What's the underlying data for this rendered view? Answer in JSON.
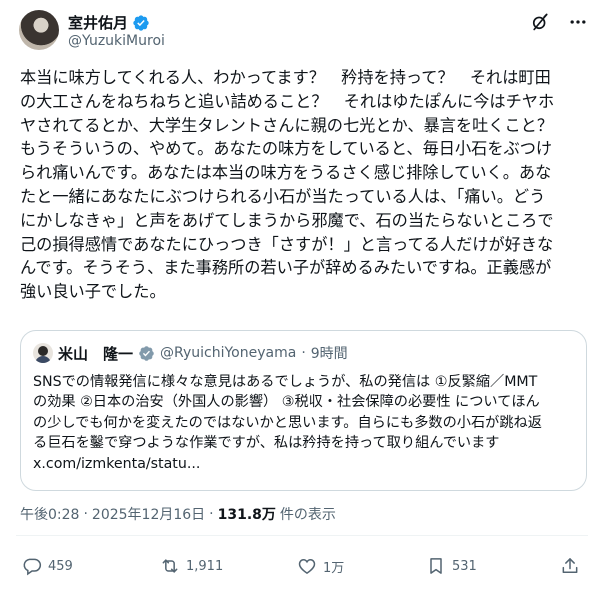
{
  "author": {
    "display_name": "室井佑月",
    "handle": "@YuzukiMuroi"
  },
  "header_icons": [
    "grok-icon",
    "more-icon"
  ],
  "tweet": {
    "text": "本当に味方してくれる人、わかってます？　矜持を持って？　それは町田\nの大工さんをねちねちと追い詰めること？　それはゆたぽんに今はチヤホ\nヤされてるとか、大学生タレントさんに親の七光とか、暴言を吐くこと？\nもうそういうの、やめて。あなたの味方をしていると、毎日小石をぶつけ\nられ痛いんです。あなたは本当の味方をうるさく感じ排除していく。あな\nたと一緒にあなたにぶつけられる小石が当たっている人は、「痛い。どう\nにかしなきゃ」と声をあげてしまうから邪魔で、石の当たらないところで\n己の損得感情であなたにひっつき「さすが！」と言ってる人だけが好きな\nんです。そうそう、また事務所の若い子が辞めるみたいですね。正義感が\n強い良い子でした。"
  },
  "quote": {
    "display_name": "米山　隆一",
    "handle": "@RyuichiYoneyama",
    "separator": "·",
    "time": "9時間",
    "text": "SNSでの情報発信に様々な意見はあるでしょうが、私の発信は ①反緊縮／MMT\nの効果 ②日本の治安（外国人の影響） ③税収・社会保障の必要性 についてほん\nの少しでも何かを変えたのではないかと思います。自らにも多数の小石が跳ね返\nる巨石を鑿で穿つような作業ですが、私は矜持を持って取り組んでいます\nx.com/izmkenta/statu..."
  },
  "meta": {
    "time": "午後0:28",
    "separator1": "·",
    "date": "2025年12月16日",
    "separator2": "·",
    "views": "131.8万",
    "views_suffix": "件の表示"
  },
  "actions": {
    "replies": "459",
    "retweets": "1,911",
    "likes": "1万",
    "bookmarks": "531"
  },
  "colors": {
    "verified": "#1d9bf0",
    "secondary_text": "#536471",
    "border": "#cfd9de"
  }
}
